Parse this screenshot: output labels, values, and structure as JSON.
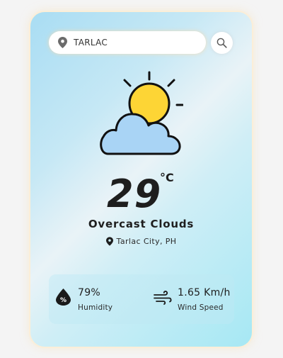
{
  "search": {
    "value": "TARLAC",
    "placeholder": ""
  },
  "weather": {
    "temperature": "29",
    "unit": "°C",
    "description": "Overcast Clouds",
    "location": "Tarlac City, PH",
    "icon": "sun-behind-cloud-icon"
  },
  "stats": {
    "humidity": {
      "value": "79%",
      "label": "Humidity",
      "icon": "humidity-drop-icon"
    },
    "wind": {
      "value": "1.65 Km/h",
      "label": "Wind Speed",
      "icon": "wind-icon"
    }
  },
  "colors": {
    "accent_sun": "#fdd535",
    "cloud": "#a9d4f5",
    "outline": "#111111",
    "card_gradient_start": "#a9ddf3",
    "card_gradient_end": "#a6e8f4"
  }
}
